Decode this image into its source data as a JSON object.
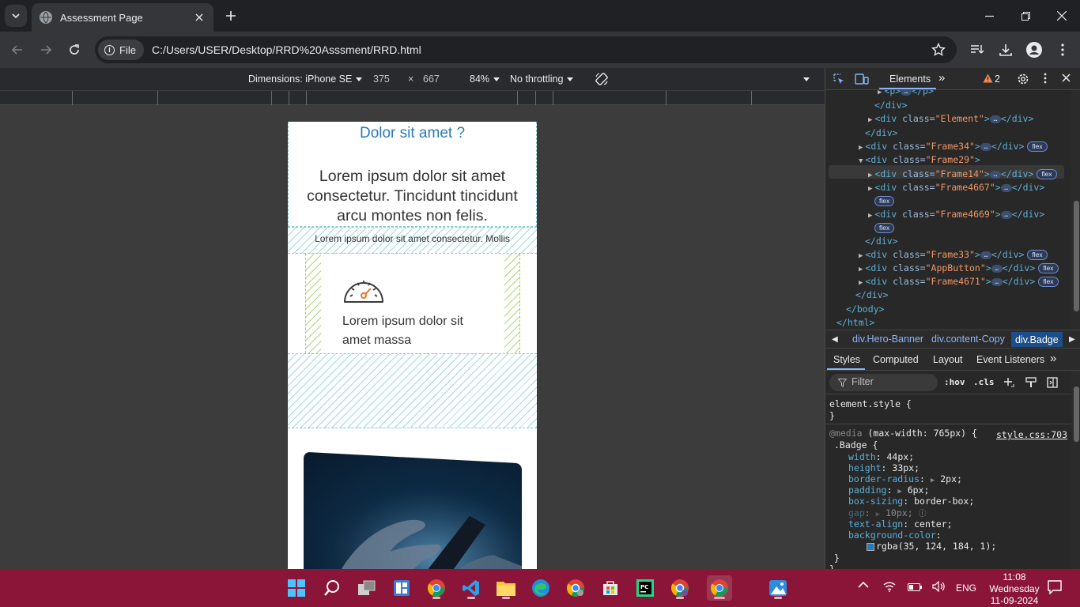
{
  "browser": {
    "tab_title": "Assessment Page",
    "chip_label": "File",
    "url": "C:/Users/USER/Desktop/RRD%20Asssment/RRD.html"
  },
  "device_toolbar": {
    "dimensions_label": "Dimensions: iPhone SE",
    "width": "375",
    "times": "×",
    "height": "667",
    "zoom": "84%",
    "throttling": "No throttling"
  },
  "page": {
    "heading": "Dolor sit amet ?",
    "lead": "Lorem ipsum dolor sit amet consectetur. Tincidunt tincidunt arcu montes non felis.",
    "strip_text": "Lorem ipsum dolor sit amet consectetur. Mollis",
    "card_text": "Lorem ipsum dolor sit amet massa"
  },
  "devtools": {
    "panel_tab": "Elements",
    "issues_count": "2",
    "dom": {
      "l0": "<p>",
      "l0b": "</p>",
      "l1": "</div>",
      "l2_class": "\"Element\"",
      "l3": "</div>",
      "l4_class": "\"Frame34\"",
      "l5_class": "\"Frame29\"",
      "l6_class": "\"Frame14\"",
      "l7_class": "\"Frame4667\"",
      "l8_class": "\"Frame4669\"",
      "l9": "</div>",
      "l10_class": "\"Frame33\"",
      "l11_class": "\"AppButton\"",
      "l12_class": "\"Frame4671\"",
      "l13": "</div>",
      "l14": "</body>",
      "l15": "</html>",
      "div_open": "<div",
      "class_attr": "class=",
      "gt": ">",
      "div_close": "</div>",
      "flex": "flex",
      "dots": "…"
    },
    "breadcrumbs": [
      "div.Hero-Banner",
      "div.content-Copy",
      "div.Badge"
    ],
    "subtabs": [
      "Styles",
      "Computed",
      "Layout",
      "Event Listeners"
    ],
    "filter_placeholder": "Filter",
    "hov": ":hov",
    "cls": ".cls",
    "styles": {
      "element_style": "element.style {",
      "close": "}",
      "media_kw": "@media",
      "media_query": "(max-width: 765px) {",
      "source": "style.css:703",
      "selector": ".Badge {",
      "props": [
        {
          "p": "width",
          "v": "44px;"
        },
        {
          "p": "height",
          "v": "33px;"
        },
        {
          "p": "border-radius",
          "v": "2px;"
        },
        {
          "p": "padding",
          "v": "6px;"
        },
        {
          "p": "box-sizing",
          "v": "border-box;"
        },
        {
          "p": "gap",
          "v": "10px;"
        },
        {
          "p": "text-align",
          "v": "center;"
        },
        {
          "p": "background-color",
          "v": ""
        }
      ],
      "bg_value": "rgba(35, 124, 184, 1);",
      "swatch_color": "#237cb8"
    }
  },
  "taskbar": {
    "language": "ENG",
    "time": "11:08",
    "day": "Wednesday",
    "date": "11-09-2024"
  }
}
